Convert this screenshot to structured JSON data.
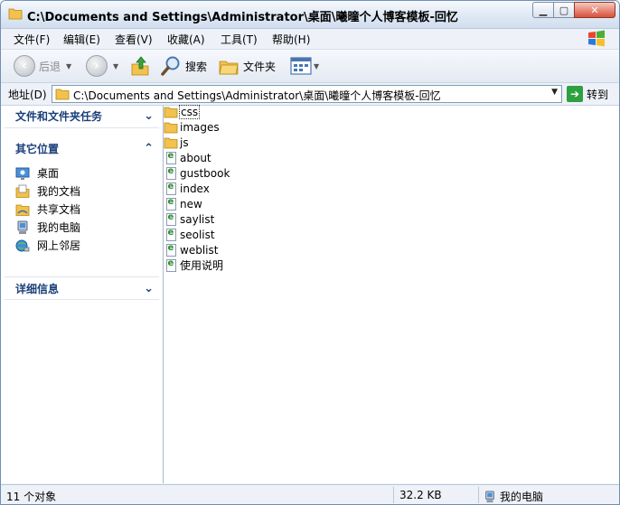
{
  "window": {
    "title": "C:\\Documents and Settings\\Administrator\\桌面\\曦曈个人博客模板-回忆"
  },
  "menu": [
    "文件(F)",
    "编辑(E)",
    "查看(V)",
    "收藏(A)",
    "工具(T)",
    "帮助(H)"
  ],
  "toolbar": {
    "back": "后退",
    "search": "搜索",
    "folders": "文件夹"
  },
  "address": {
    "label": "地址(D)",
    "value": "C:\\Documents and Settings\\Administrator\\桌面\\曦曈个人博客模板-回忆",
    "go": "转到"
  },
  "left_pane": {
    "tasks_title": "文件和文件夹任务",
    "places_title": "其它位置",
    "places": [
      "桌面",
      "我的文档",
      "共享文档",
      "我的电脑",
      "网上邻居"
    ],
    "details_title": "详细信息"
  },
  "files": [
    {
      "name": "css",
      "type": "folder"
    },
    {
      "name": "images",
      "type": "folder"
    },
    {
      "name": "js",
      "type": "folder"
    },
    {
      "name": "about",
      "type": "html"
    },
    {
      "name": "gustbook",
      "type": "html"
    },
    {
      "name": "index",
      "type": "html"
    },
    {
      "name": "new",
      "type": "html"
    },
    {
      "name": "saylist",
      "type": "html"
    },
    {
      "name": "seolist",
      "type": "html"
    },
    {
      "name": "weblist",
      "type": "html"
    },
    {
      "name": "使用说明",
      "type": "html"
    }
  ],
  "status": {
    "objects": "11 个对象",
    "size": "32.2 KB",
    "location": "我的电脑"
  },
  "colors": {
    "section_header": "#1a3e7a",
    "folder": "#f2c14e",
    "go_button": "#2ea040",
    "close_button": "#d9503a"
  }
}
